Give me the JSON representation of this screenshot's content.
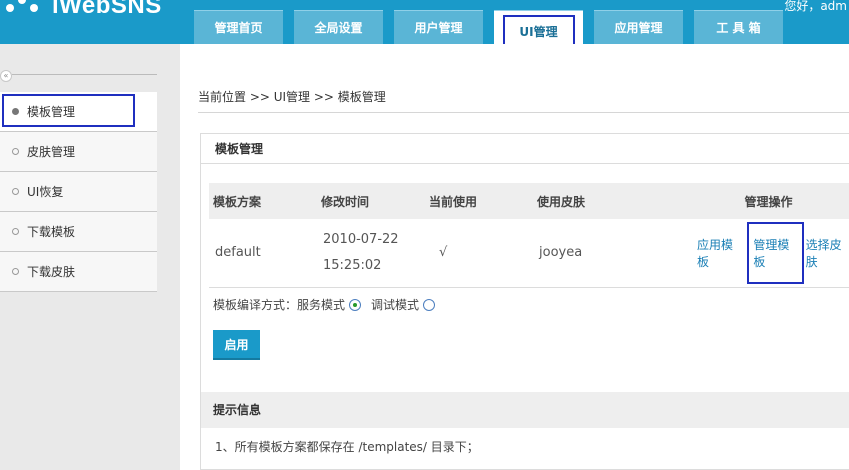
{
  "header": {
    "logo_text": "iWebSNS",
    "welcome": "您好，adm",
    "nav": [
      {
        "label": "管理首页"
      },
      {
        "label": "全局设置"
      },
      {
        "label": "用户管理"
      },
      {
        "label": "UI管理"
      },
      {
        "label": "应用管理"
      },
      {
        "label": "工 具 箱"
      }
    ]
  },
  "sidebar": {
    "collapse_glyph": "«",
    "items": [
      {
        "label": "模板管理"
      },
      {
        "label": "皮肤管理"
      },
      {
        "label": "UI恢复"
      },
      {
        "label": "下载模板"
      },
      {
        "label": "下载皮肤"
      }
    ]
  },
  "main": {
    "breadcrumb": "当前位置 >> UI管理 >> 模板管理",
    "panel_title": "模板管理",
    "table": {
      "headers": [
        "模板方案",
        "修改时间",
        "当前使用",
        "使用皮肤",
        "管理操作"
      ],
      "row": {
        "scheme": "default",
        "date": "2010-07-22",
        "time": "15:25:02",
        "in_use": "√",
        "skin": "jooyea",
        "ops": [
          "应用模板",
          "管理模板",
          "选择皮肤"
        ]
      }
    },
    "compile": {
      "label": "模板编译方式：",
      "service_mode": "服务模式",
      "debug_mode": "调试模式",
      "selected": "服务模式"
    },
    "enable_button": "启用",
    "tips": {
      "title": "提示信息",
      "line1": "1、所有模板方案都保存在 /templates/ 目录下；"
    }
  },
  "colors": {
    "header_bg": "#1a9ac9",
    "highlight_box": "#1f2fbf",
    "link": "#1a7fb5"
  }
}
